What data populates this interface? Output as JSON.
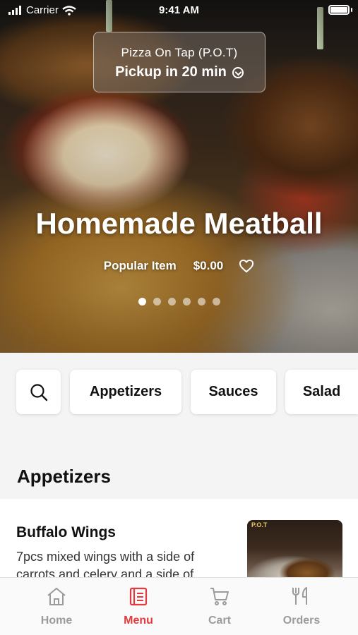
{
  "status_bar": {
    "carrier": "Carrier",
    "time": "9:41 AM"
  },
  "pickup": {
    "location": "Pizza On Tap (P.O.T)",
    "pickup_label": "Pickup in 20 min"
  },
  "hero": {
    "title": "Homemade Meatball",
    "tag": "Popular Item",
    "price": "$0.00",
    "slide_count": 6,
    "active_slide": 1
  },
  "categories": {
    "search_icon": "search-icon",
    "items": [
      "Appetizers",
      "Sauces",
      "Salad"
    ]
  },
  "section": {
    "title": "Appetizers"
  },
  "menu_item": {
    "name": "Buffalo Wings",
    "description": "7pcs mixed wings with a side of carrots and celery and a side of...",
    "thumb_label": "P.O.T"
  },
  "tabbar": {
    "tabs": [
      {
        "label": "Home",
        "icon": "home-icon"
      },
      {
        "label": "Menu",
        "icon": "menu-book-icon"
      },
      {
        "label": "Cart",
        "icon": "cart-icon"
      },
      {
        "label": "Orders",
        "icon": "fork-knife-icon"
      }
    ],
    "active": "Menu"
  },
  "colors": {
    "accent": "#e53940",
    "inactive_tab": "#9b9b9b"
  }
}
